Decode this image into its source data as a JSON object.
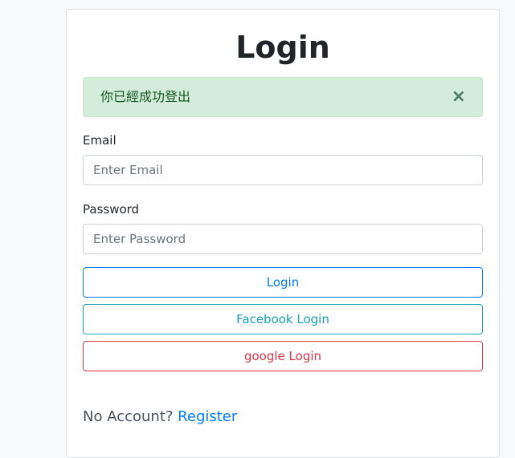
{
  "page": {
    "title": "Login"
  },
  "alert": {
    "message": "你已經成功登出",
    "close_symbol": "×",
    "color": "#155724",
    "background": "#d4edda"
  },
  "form": {
    "email_label": "Email",
    "email_placeholder": "Enter Email",
    "email_value": "",
    "password_label": "Password",
    "password_placeholder": "Enter Password",
    "password_value": ""
  },
  "buttons": {
    "login_label": "Login",
    "facebook_label": "Facebook Login",
    "google_label": "google Login",
    "login_color": "#007bff",
    "facebook_color": "#17a2b8",
    "google_color": "#dc3545"
  },
  "footer": {
    "no_account_text": "No Account?",
    "register_link": "Register"
  }
}
